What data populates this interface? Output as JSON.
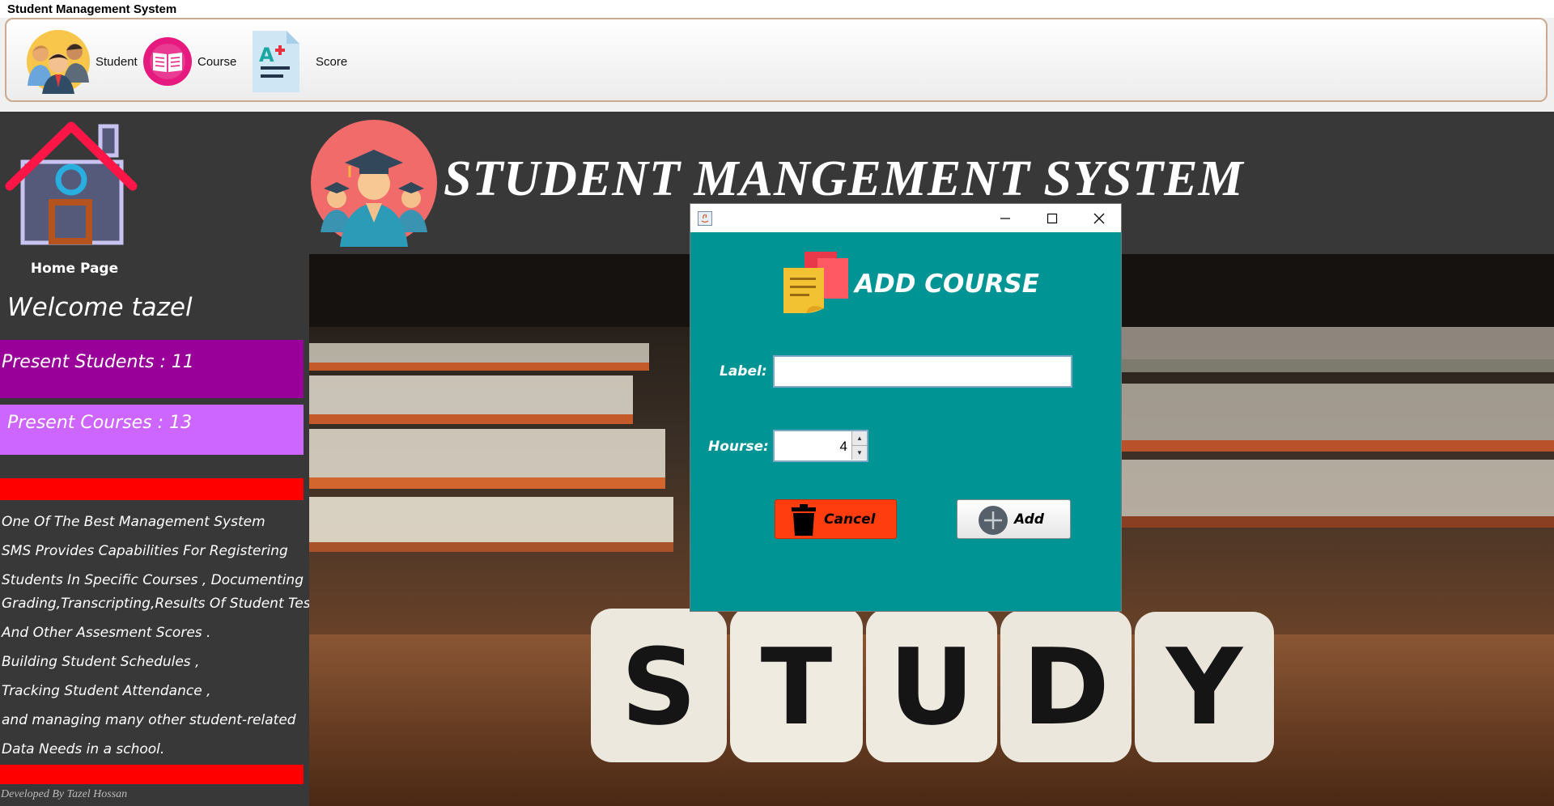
{
  "window": {
    "title": "Student Management System"
  },
  "toolbar": {
    "items": [
      {
        "label": "Student",
        "icon": "students-group-icon"
      },
      {
        "label": "Course",
        "icon": "book-icon"
      },
      {
        "label": "Score",
        "icon": "grade-document-icon"
      }
    ]
  },
  "sidebar": {
    "home_label": "Home Page",
    "welcome": "Welcome tazel",
    "present_students": "Present Students : 11",
    "present_courses": "Present Courses : 13",
    "description_lines": [
      "One Of The Best Management System",
      "SMS Provides Capabilities For Registering",
      "Students In Specific Courses  , Documenting",
      "Grading,Transcripting,Results Of Student Tests",
      "And Other Assesment Scores .",
      " Building Student Schedules ,",
      "Tracking Student Attendance ,",
      " and managing many other student-related",
      " Data Needs in a school."
    ],
    "developer": "Developed By Tazel Hossan"
  },
  "header": {
    "title": "STUDENT MANGEMENT SYSTEM"
  },
  "background_image": {
    "word": "STUDY",
    "letters": [
      "S",
      "T",
      "U",
      "D",
      "Y"
    ]
  },
  "dialog": {
    "title": "ADD COURSE",
    "label_field": {
      "label": "Label:",
      "value": ""
    },
    "hours_field": {
      "label": "Hourse:",
      "value": "4"
    },
    "cancel_label": "Cancel",
    "add_label": "Add"
  },
  "colors": {
    "present_students_bg": "#990099",
    "present_courses_bg": "#cc66ff",
    "dialog_bg": "#009494",
    "cancel_bg": "#ff3d0f",
    "red_divider": "#ff0000"
  }
}
